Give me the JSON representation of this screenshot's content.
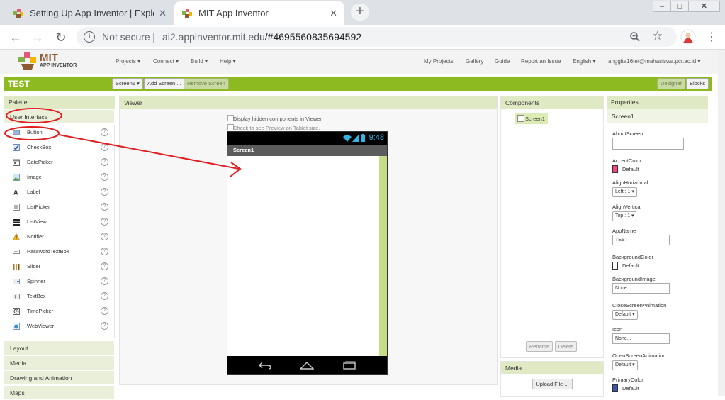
{
  "browser": {
    "tabs": [
      {
        "title": "Setting Up App Inventor | Explore",
        "active": false
      },
      {
        "title": "MIT App Inventor",
        "active": true
      }
    ],
    "new_tab": "+",
    "security": "Not secure",
    "url_host": "ai2.appinventor.mit.edu",
    "url_path": "/#4695560835694592",
    "window_controls": [
      "–",
      "□",
      "✕"
    ]
  },
  "app": {
    "logo_title": "MIT",
    "logo_subtitle": "APP INVENTOR",
    "menus": [
      "Projects ▾",
      "Connect ▾",
      "Build ▾",
      "Help ▾"
    ],
    "right_links": [
      "My Projects",
      "Gallery",
      "Guide",
      "Report an Issue",
      "English ▾",
      "anggita16tet@mahasiswa.pcr.ac.id ▾"
    ]
  },
  "project": {
    "name": "TEST",
    "screen_select": "Screen1 ▾",
    "add_screen": "Add Screen ...",
    "remove_screen": "Remove Screen",
    "designer": "Designer",
    "blocks": "Blocks"
  },
  "palette": {
    "header": "Palette",
    "open_category": "User Interface",
    "items": [
      "Button",
      "CheckBox",
      "DatePicker",
      "Image",
      "Label",
      "ListPicker",
      "ListView",
      "Notifier",
      "PasswordTextBox",
      "Slider",
      "Spinner",
      "TextBox",
      "TimePicker",
      "WebViewer"
    ],
    "help_glyph": "?",
    "other_categories": [
      "Layout",
      "Media",
      "Drawing and Animation",
      "Maps"
    ]
  },
  "viewer": {
    "header": "Viewer",
    "option_hidden": "Display hidden components in Viewer",
    "option_tablet": "Check to see Preview on Tablet size.",
    "phone_time": "9:48",
    "screen_title": "Screen1"
  },
  "components": {
    "header": "Components",
    "tree_root": "Screen1",
    "rename": "Rename",
    "delete": "Delete"
  },
  "media": {
    "header": "Media",
    "upload": "Upload File ..."
  },
  "properties": {
    "header": "Properties",
    "component": "Screen1",
    "about_screen": "AboutScreen",
    "accent_color": "AccentColor",
    "accent_value": "Default",
    "align_h": "AlignHorizontal",
    "align_h_value": "Left : 1 ▾",
    "align_v": "AlignVertical",
    "align_v_value": "Top : 1 ▾",
    "app_name": "AppName",
    "app_name_value": "TEST",
    "bg_color": "BackgroundColor",
    "bg_color_value": "Default",
    "bg_image": "BackgroundImage",
    "bg_image_value": "None...",
    "close_anim": "CloseScreenAnimation",
    "close_anim_value": "Default ▾",
    "icon": "Icon",
    "icon_value": "None...",
    "open_anim": "OpenScreenAnimation",
    "open_anim_value": "Default ▾",
    "primary_color": "PrimaryColor",
    "primary_value": "Default"
  },
  "colors": {
    "brand_green": "#8cba20",
    "panel_header": "#dfe9c3",
    "annotation_red": "#e02020",
    "accent_swatch": "#ff4081",
    "primary_swatch": "#3f51b5"
  }
}
